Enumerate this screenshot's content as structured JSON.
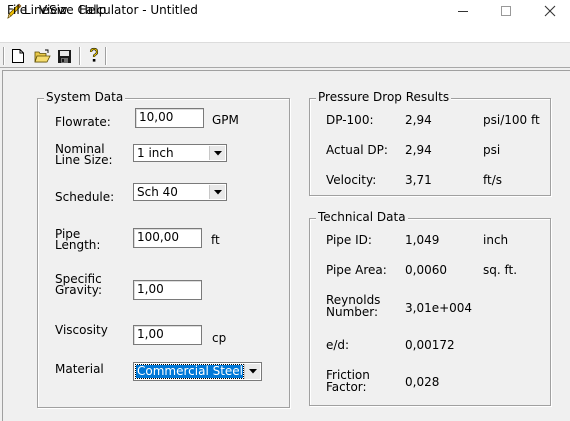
{
  "window": {
    "title": "LineSize Calculator - Untitled",
    "controls": {
      "minimize": "—",
      "maximize": "☐",
      "close": "✕"
    }
  },
  "menu": {
    "file": "File",
    "view": "View",
    "help": "Help"
  },
  "toolbar": {
    "icons": [
      "new-document-icon",
      "open-folder-icon",
      "save-disk-icon",
      "context-help-icon"
    ]
  },
  "system_data": {
    "title": "System Data",
    "flowrate": {
      "label": "Flowrate:",
      "value": "10,00",
      "unit": "GPM"
    },
    "line_size": {
      "label_line1": "Nominal",
      "label_line2": "Line Size:",
      "value": "1 inch"
    },
    "schedule": {
      "label": "Schedule:",
      "value": "Sch 40"
    },
    "pipe_length": {
      "label_line1": "Pipe",
      "label_line2": "Length:",
      "value": "100,00",
      "unit": "ft"
    },
    "specific_gravity": {
      "label_line1": "Specific",
      "label_line2": "Gravity:",
      "value": "1,00"
    },
    "viscosity": {
      "label": "Viscosity",
      "value": "1,00",
      "unit": "cp"
    },
    "material": {
      "label": "Material",
      "value": "Commercial Steel"
    }
  },
  "pressure_drop": {
    "title": "Pressure Drop Results",
    "rows": [
      {
        "label": "DP-100:",
        "value": "2,94",
        "unit": "psi/100 ft"
      },
      {
        "label": "Actual DP:",
        "value": "2,94",
        "unit": "psi"
      },
      {
        "label": "Velocity:",
        "value": "3,71",
        "unit": "ft/s"
      }
    ]
  },
  "technical_data": {
    "title": "Technical Data",
    "pipe_id": {
      "label": "Pipe ID:",
      "value": "1,049",
      "unit": "inch"
    },
    "pipe_area": {
      "label": "Pipe Area:",
      "value": "0,0060",
      "unit": "sq. ft."
    },
    "reynolds": {
      "label_line1": "Reynolds",
      "label_line2": "Number:",
      "value": "3,01e+004"
    },
    "roughness": {
      "label": "e/d:",
      "value": "0,00172"
    },
    "friction": {
      "label_line1": "Friction",
      "label_line2": "Factor:",
      "value": "0,028"
    }
  },
  "colors": {
    "selection": "#0078d7",
    "dialog_bg": "#f0f0f0",
    "group_border": "#a0a0a0"
  }
}
